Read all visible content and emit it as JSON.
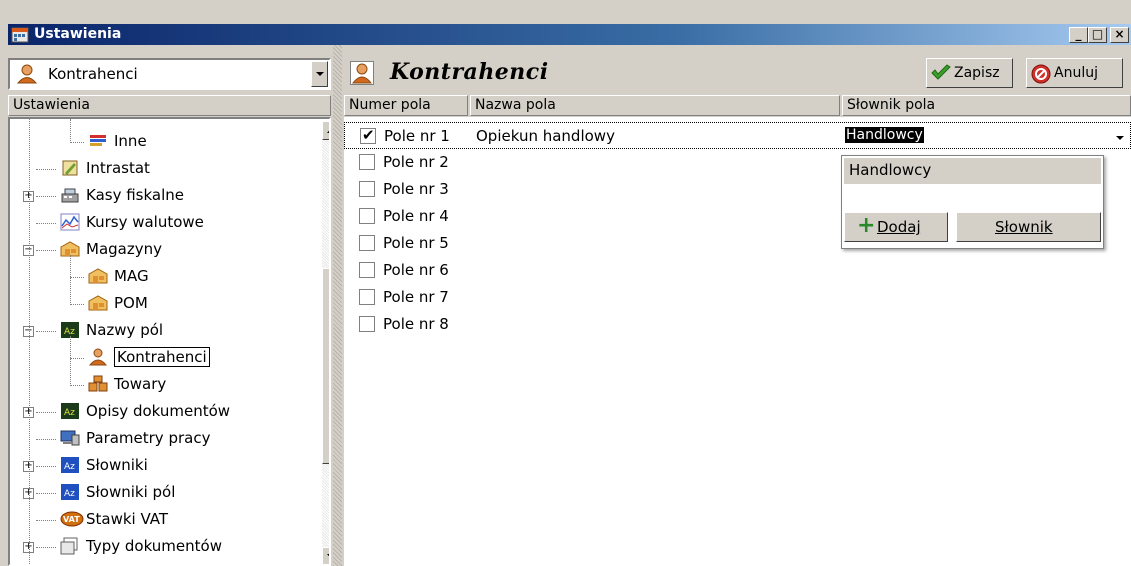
{
  "window": {
    "title": "Ustawienia",
    "minimize": "_",
    "maximize": "□",
    "close": "×"
  },
  "left": {
    "combo_value": "Kontrahenci",
    "header": "Ustawienia",
    "tree": [
      {
        "label": "Inne",
        "icon": "folder-icon",
        "level": 3,
        "expander": ""
      },
      {
        "label": "Intrastat",
        "icon": "pencil-icon",
        "level": 2,
        "expander": ""
      },
      {
        "label": "Kasy fiskalne",
        "icon": "cash-register-icon",
        "level": 2,
        "expander": "+"
      },
      {
        "label": "Kursy walutowe",
        "icon": "chart-icon",
        "level": 2,
        "expander": ""
      },
      {
        "label": "Magazyny",
        "icon": "warehouse-icon",
        "level": 2,
        "expander": "−"
      },
      {
        "label": "MAG",
        "icon": "warehouse-icon",
        "level": 3,
        "expander": ""
      },
      {
        "label": "POM",
        "icon": "warehouse-icon",
        "level": 3,
        "expander": ""
      },
      {
        "label": "Nazwy pól",
        "icon": "az-icon",
        "level": 2,
        "expander": "−"
      },
      {
        "label": "Kontrahenci",
        "icon": "person-icon",
        "level": 3,
        "expander": "",
        "selected": true
      },
      {
        "label": "Towary",
        "icon": "boxes-icon",
        "level": 3,
        "expander": ""
      },
      {
        "label": "Opisy dokumentów",
        "icon": "az-icon",
        "level": 2,
        "expander": "+"
      },
      {
        "label": "Parametry pracy",
        "icon": "computer-icon",
        "level": 2,
        "expander": ""
      },
      {
        "label": "Słowniki",
        "icon": "az-blue-icon",
        "level": 2,
        "expander": "+"
      },
      {
        "label": "Słowniki pól",
        "icon": "az-blue-icon",
        "level": 2,
        "expander": "+"
      },
      {
        "label": "Stawki VAT",
        "icon": "vat-icon",
        "level": 2,
        "expander": ""
      },
      {
        "label": "Typy dokumentów",
        "icon": "document-icon",
        "level": 2,
        "expander": "+"
      }
    ]
  },
  "right": {
    "title": "Kontrahenci",
    "save_label": "Zapisz",
    "cancel_label": "Anuluj",
    "columns": [
      "Numer pola",
      "Nazwa pola",
      "Słownik pola"
    ],
    "rows": [
      {
        "checked": true,
        "label": "Pole nr 1",
        "name": "Opiekun handlowy",
        "dict": "Handlowcy"
      },
      {
        "checked": false,
        "label": "Pole nr 2",
        "name": "",
        "dict": ""
      },
      {
        "checked": false,
        "label": "Pole nr 3",
        "name": "",
        "dict": ""
      },
      {
        "checked": false,
        "label": "Pole nr 4",
        "name": "",
        "dict": ""
      },
      {
        "checked": false,
        "label": "Pole nr 5",
        "name": "",
        "dict": ""
      },
      {
        "checked": false,
        "label": "Pole nr 6",
        "name": "",
        "dict": ""
      },
      {
        "checked": false,
        "label": "Pole nr 7",
        "name": "",
        "dict": ""
      },
      {
        "checked": false,
        "label": "Pole nr 8",
        "name": "",
        "dict": ""
      }
    ],
    "dropdown": {
      "items": [
        "Handlowcy"
      ],
      "add_label": "Dodaj",
      "dict_label": "Słownik"
    }
  },
  "colors": {
    "titlebar": "#0a246a",
    "face": "#d4d0c8",
    "check_green": "#3aa02a",
    "cancel_red": "#d0302a",
    "person_orange": "#d2691e"
  }
}
